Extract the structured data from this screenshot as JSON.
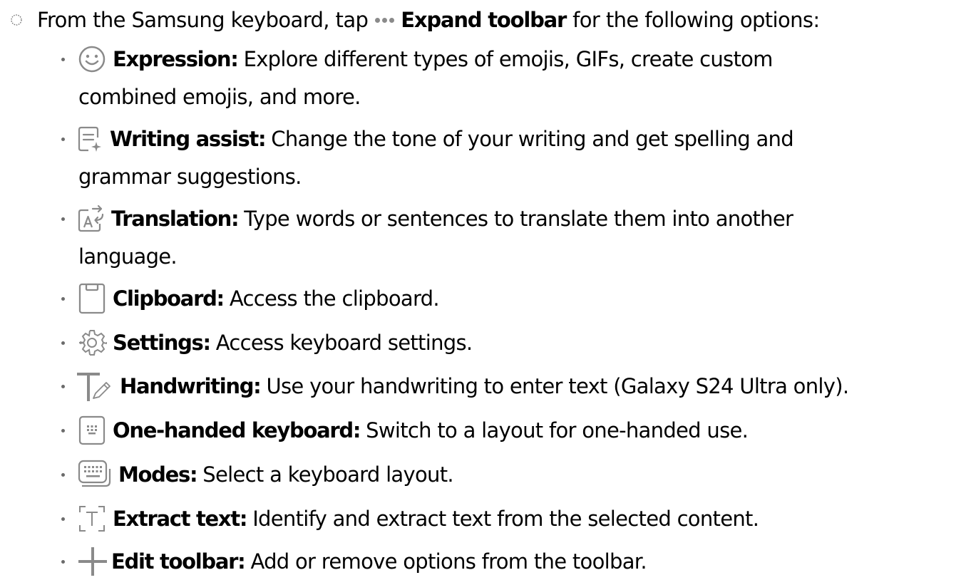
{
  "intro": {
    "prefix": "From the Samsung keyboard, tap",
    "action": "Expand toolbar",
    "suffix": "for the following options:",
    "icon": "more-dots-icon"
  },
  "items": [
    {
      "icon": "smiley-face-icon",
      "label": "Expression:",
      "desc": "Explore different types of emojis, GIFs, create custom",
      "desc2": "combined emojis, and more."
    },
    {
      "icon": "writing-assist-icon",
      "label": "Writing assist:",
      "desc": "Change the tone of your writing and get spelling and",
      "desc2": "grammar suggestions."
    },
    {
      "icon": "translate-icon",
      "label": "Translation:",
      "desc": "Type words or sentences to translate them into another",
      "desc2": "language."
    },
    {
      "icon": "clipboard-icon",
      "label": "Clipboard:",
      "desc": "Access the clipboard."
    },
    {
      "icon": "gear-icon",
      "label": "Settings:",
      "desc": "Access keyboard settings."
    },
    {
      "icon": "handwriting-icon",
      "label": "Handwriting:",
      "desc": "Use your handwriting to enter text (Galaxy S24 Ultra only)."
    },
    {
      "icon": "one-handed-keyboard-icon",
      "label": "One-handed keyboard:",
      "desc": "Switch to a layout for one-handed use."
    },
    {
      "icon": "keyboard-modes-icon",
      "label": "Modes:",
      "desc": "Select a keyboard layout."
    },
    {
      "icon": "extract-text-icon",
      "label": "Extract text:",
      "desc": "Identify and extract text from the selected content."
    },
    {
      "icon": "plus-icon",
      "label": "Edit toolbar:",
      "desc": "Add or remove options from the toolbar."
    }
  ]
}
